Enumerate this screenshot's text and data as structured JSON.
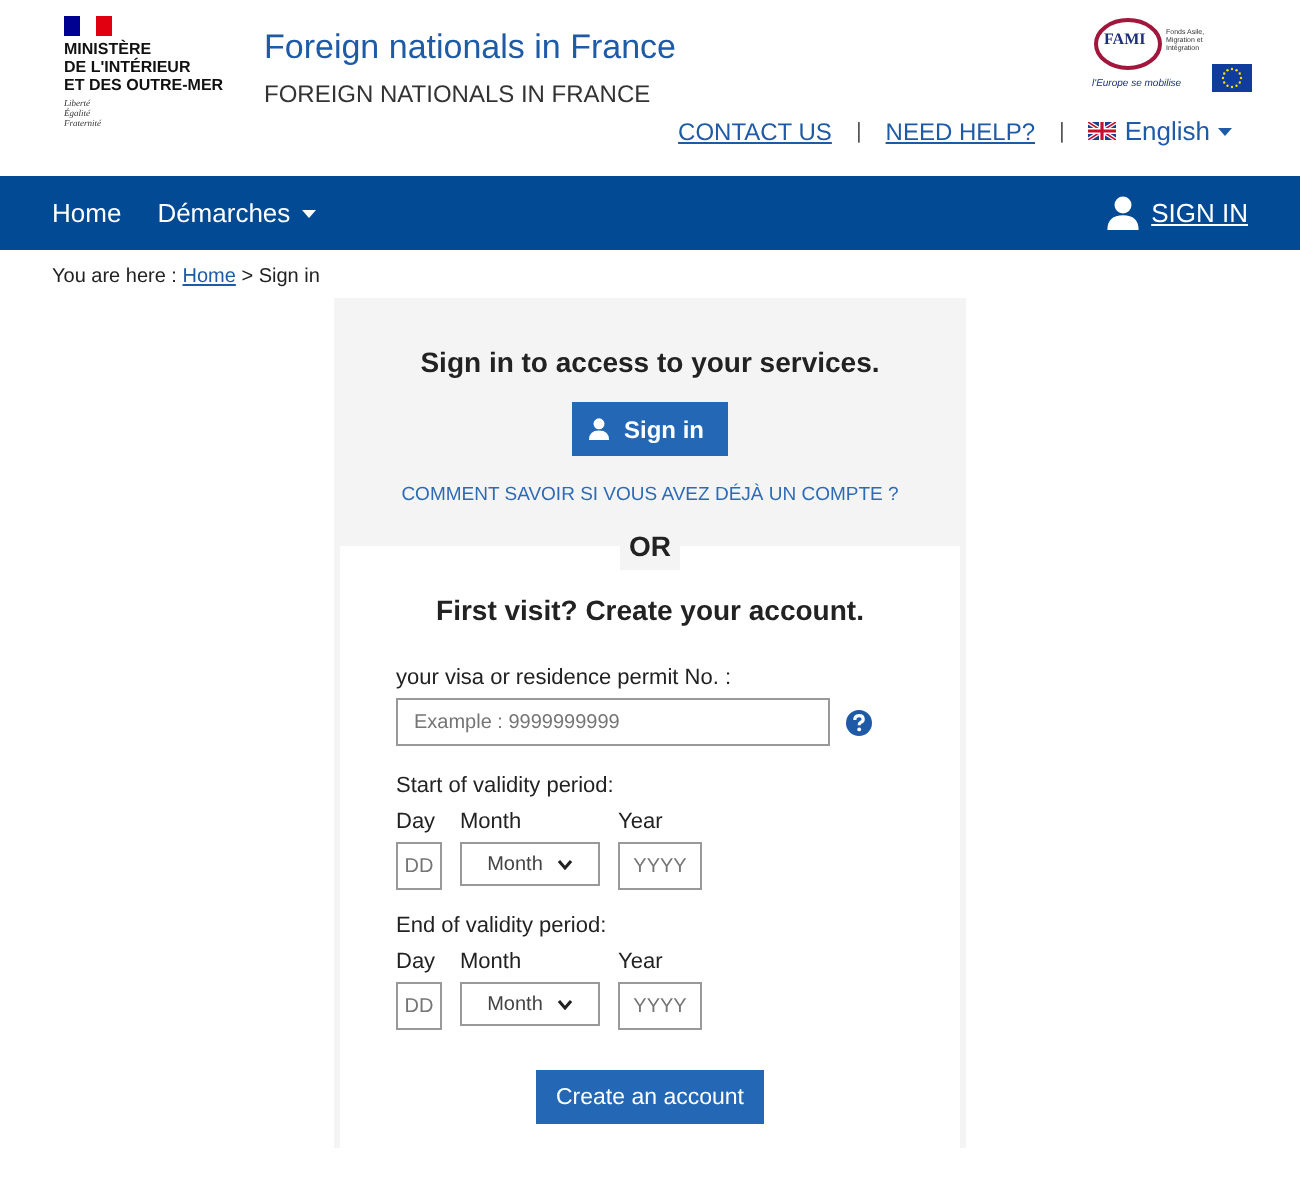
{
  "header": {
    "ministry_lines": [
      "MINISTÈRE",
      "DE L'INTÉRIEUR",
      "ET DES OUTRE-MER"
    ],
    "motto": [
      "Liberté",
      "Égalité",
      "Fraternité"
    ],
    "title": "Foreign nationals in France",
    "subtitle": "FOREIGN NATIONALS IN FRANCE",
    "fami": {
      "name": "FAMI",
      "caption": "Fonds Asile, Migration et Intégration",
      "slogan": "l'Europe se mobilise"
    },
    "links": [
      {
        "label": "CONTACT US"
      },
      {
        "label": "NEED HELP?"
      }
    ],
    "separator": "|",
    "language": "English"
  },
  "nav": {
    "items": [
      {
        "label": "Home",
        "dropdown": false
      },
      {
        "label": "Démarches",
        "dropdown": true
      }
    ],
    "sign_in": "SIGN IN"
  },
  "breadcrumb": {
    "prefix": "You are here :",
    "link": "Home",
    "current": "> Sign in"
  },
  "sign_in": {
    "heading": "Sign in to access to your services.",
    "button": "Sign in",
    "help_link": "COMMENT SAVOIR SI VOUS AVEZ DÉJÀ UN COMPTE ?"
  },
  "or": "OR",
  "create": {
    "heading": "First visit? Create your account.",
    "permit_label": "your visa or residence permit No. :",
    "permit_placeholder": "Example : 9999999999",
    "periods": [
      {
        "label": "Start of validity period:",
        "day": "Day",
        "month": "Month",
        "year": "Year",
        "day_placeholder": "DD",
        "month_value": "Month",
        "year_placeholder": "YYYY"
      },
      {
        "label": "End of validity period:",
        "day": "Day",
        "month": "Month",
        "year": "Year",
        "day_placeholder": "DD",
        "month_value": "Month",
        "year_placeholder": "YYYY"
      }
    ],
    "button": "Create an account"
  }
}
